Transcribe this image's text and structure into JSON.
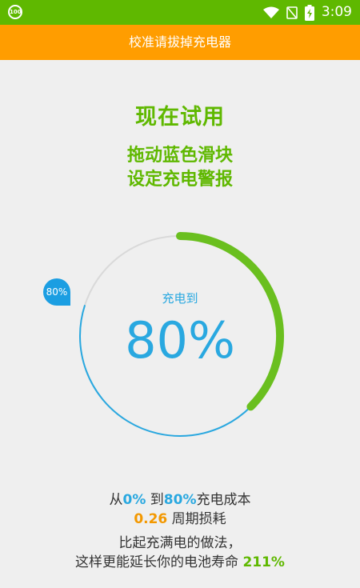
{
  "status_bar": {
    "left_badge": "100",
    "time": "3:09",
    "icons": [
      "wifi-icon",
      "no-signal-icon",
      "battery-charging-icon"
    ]
  },
  "title_bar": {
    "title": "校准请拔掉充电器"
  },
  "headline": "现在试用",
  "instruction": {
    "line1": "拖动蓝色滑块",
    "line2": "设定充电警报"
  },
  "dial": {
    "label": "充电到",
    "value": "80%",
    "slider_badge": "80%",
    "charge_fraction": 0.8,
    "colors": {
      "progress": "#6abf1f",
      "track": "#d9d9d9",
      "target": "#29a8e0"
    }
  },
  "summary": {
    "line1_prefix": "从",
    "line1_from": "0%",
    "line1_to_word": " 到",
    "line1_to": "80%",
    "line1_suffix": "充电成本",
    "line2_value": "0.26",
    "line2_suffix": " 周期损耗",
    "line3": "比起充满电的做法，",
    "line4_prefix": "这样更能延长你的电池寿命 ",
    "line4_value": "211%"
  }
}
